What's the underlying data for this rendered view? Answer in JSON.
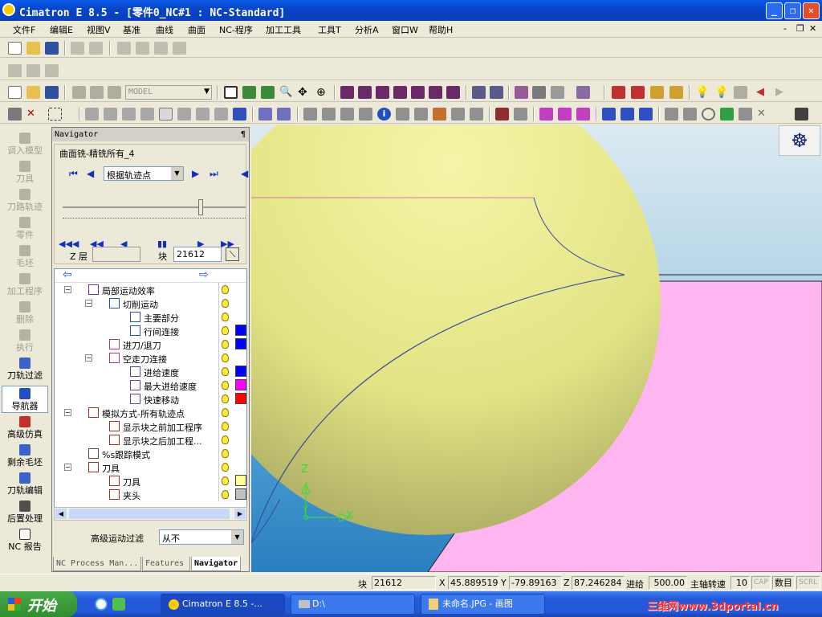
{
  "window": {
    "title": "Cimatron E 8.5 - [零件0_NC#1 : NC-Standard]",
    "min": "_",
    "max": "❐",
    "close": "✕"
  },
  "menu": [
    "文件F",
    "编辑E",
    "视图V",
    "基准",
    "曲线",
    "曲面",
    "NC-程序",
    "加工工具",
    "工具T",
    "分析A",
    "窗口W",
    "帮助H"
  ],
  "mdi": {
    "min": "-",
    "restore": "❐",
    "close": "✕"
  },
  "toolbar": {
    "model_select": "MODEL"
  },
  "leftbar": [
    {
      "label": "调入模型",
      "state": "disabled"
    },
    {
      "label": "刀具",
      "state": "disabled"
    },
    {
      "label": "刀路轨迹",
      "state": "disabled"
    },
    {
      "label": "零件",
      "state": "disabled"
    },
    {
      "label": "毛坯",
      "state": "disabled"
    },
    {
      "label": "加工程序",
      "state": "disabled"
    },
    {
      "label": "删除",
      "state": "disabled"
    },
    {
      "label": "执行",
      "state": "disabled"
    },
    {
      "label": "刀轨过滤",
      "state": "enabled"
    },
    {
      "label": "导航器",
      "state": "active"
    },
    {
      "label": "高级仿真",
      "state": "enabled"
    },
    {
      "label": "剩余毛坯",
      "state": "enabled"
    },
    {
      "label": "刀轨编辑",
      "state": "enabled"
    },
    {
      "label": "后置处理",
      "state": "enabled"
    },
    {
      "label": "NC 报告",
      "state": "enabled"
    }
  ],
  "navigator": {
    "title": "Navigator",
    "pin": "¶",
    "operation": "曲面铣-精铣所有_4",
    "mode_select": "根据轨迹点",
    "z_label": "Z 层",
    "z_value": "",
    "block_label": "块",
    "block_value": "21612",
    "filter_label": "高级运动过滤",
    "filter_value": "从不",
    "tree": [
      {
        "label": "局部运动效率",
        "level": 0,
        "expand": "−",
        "swatch": ""
      },
      {
        "label": "切削运动",
        "level": 1,
        "expand": "−",
        "swatch": ""
      },
      {
        "label": "主要部分",
        "level": 2,
        "expand": "",
        "swatch": ""
      },
      {
        "label": "行间连接",
        "level": 2,
        "expand": "",
        "swatch": "#0000ff"
      },
      {
        "label": "进刀/退刀",
        "level": 1,
        "expand": "",
        "swatch": "#0000ff"
      },
      {
        "label": "空走刀连接",
        "level": 1,
        "expand": "−",
        "swatch": ""
      },
      {
        "label": "进给速度",
        "level": 2,
        "expand": "",
        "swatch": "#0000ff"
      },
      {
        "label": "最大进给速度",
        "level": 2,
        "expand": "",
        "swatch": "#ff00ff"
      },
      {
        "label": "快速移动",
        "level": 2,
        "expand": "",
        "swatch": "#ff0000"
      },
      {
        "label": "模拟方式-所有轨迹点",
        "level": 0,
        "expand": "−",
        "swatch": ""
      },
      {
        "label": "显示块之前加工程序",
        "level": 1,
        "expand": "",
        "swatch": ""
      },
      {
        "label": "显示块之后加工程...",
        "level": 1,
        "expand": "",
        "swatch": ""
      },
      {
        "label": "%s跟踪模式",
        "level": 0,
        "expand": "",
        "swatch": ""
      },
      {
        "label": "刀具",
        "level": 0,
        "expand": "−",
        "swatch": ""
      },
      {
        "label": "刀具",
        "level": 1,
        "expand": "",
        "swatch": "#ffff99"
      },
      {
        "label": "夹头",
        "level": 1,
        "expand": "",
        "swatch": "#c0c0c0"
      }
    ],
    "tabs": [
      "NC Process Man...",
      "Features",
      "Navigator"
    ]
  },
  "viewport": {
    "axis_x": "X",
    "axis_y": "Y",
    "axis_z": "Z"
  },
  "status": {
    "block_label": "块",
    "block": "21612",
    "x_label": "X",
    "x": "45.889519",
    "y_label": "Y",
    "y": "-79.89163",
    "z_label": "Z",
    "z": "87.246284",
    "feed_label": "进给",
    "feed": "500.00",
    "spindle_label": "主轴转速",
    "spindle": "10",
    "cap": "CAP",
    "num": "数目",
    "scrl": "SCRL"
  },
  "taskbar": {
    "start": "开始",
    "tasks": [
      "Cimatron E 8.5 -...",
      "D:\\",
      "未命名.JPG - 画图"
    ],
    "watermark": "三维网www.3dportal.cn"
  }
}
